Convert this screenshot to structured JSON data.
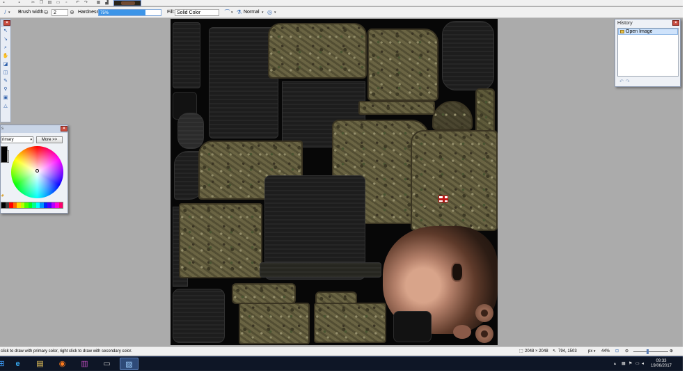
{
  "toolbar": {
    "brush_width_label": "Brush width:",
    "brush_width_value": "2",
    "hardness_label": "Hardness:",
    "hardness_value": "75%",
    "hardness_fraction": 0.75,
    "fill_label": "Fill:",
    "fill_value": "Solid Color",
    "blend_mode_value": "Normal"
  },
  "colors_window": {
    "mode_value": "rimary",
    "more_button_label": "More >>",
    "primary_color": "#000000",
    "secondary_color": "#ffffff",
    "palette": [
      "#000000",
      "#404040",
      "#ff0000",
      "#ff6a00",
      "#ffd800",
      "#b6ff00",
      "#4cff00",
      "#00ff21",
      "#00ff90",
      "#00ffff",
      "#0094ff",
      "#0026ff",
      "#4800ff",
      "#b200ff",
      "#ff00dc",
      "#ff006e"
    ]
  },
  "history_window": {
    "title": "History",
    "items": [
      "Open Image"
    ]
  },
  "status": {
    "hint": "click to draw with primary color, right click to draw with secondary color.",
    "image_size": "2048 × 2048",
    "cursor_pos": "794, 1503",
    "unit": "px",
    "zoom": "44%"
  },
  "taskbar": {
    "time": "09:33",
    "date": "19/06/2017"
  },
  "colors": {
    "accent": "#3d95e8",
    "taskbar": "#0e1626",
    "close": "#c94b3e"
  }
}
